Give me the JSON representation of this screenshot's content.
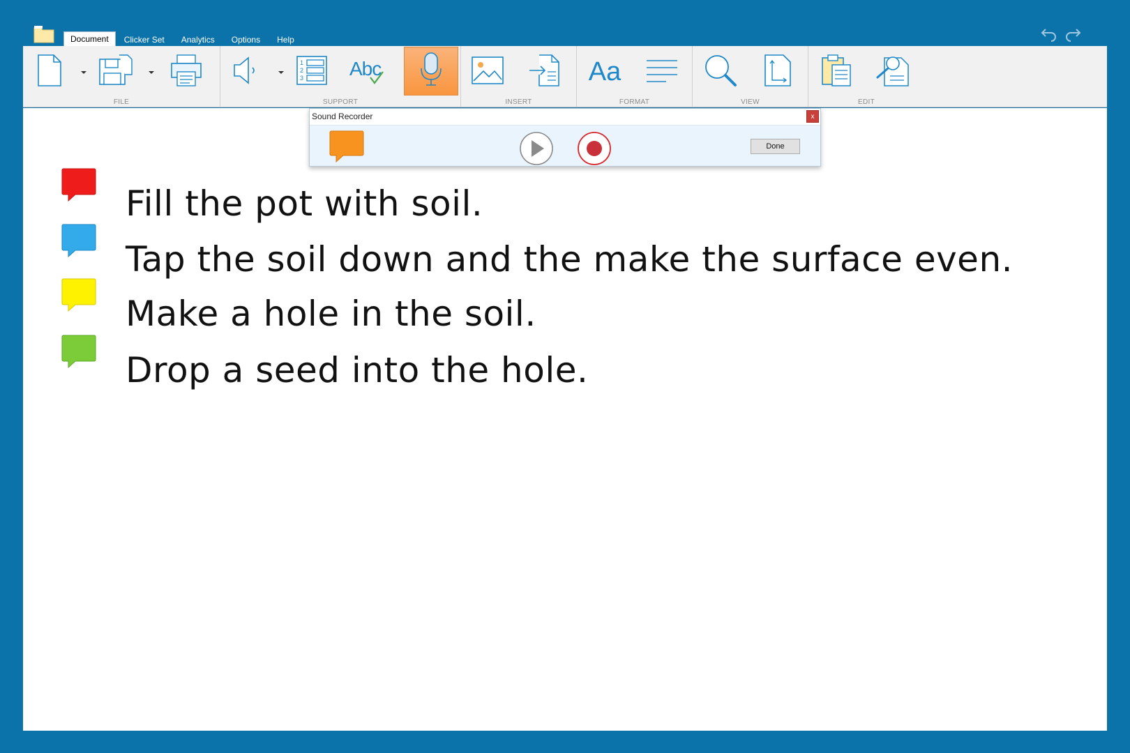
{
  "menu": {
    "tabs": [
      {
        "label": "Document",
        "active": true
      },
      {
        "label": "Clicker Set"
      },
      {
        "label": "Analytics"
      },
      {
        "label": "Options"
      },
      {
        "label": "Help"
      }
    ]
  },
  "ribbon": {
    "groups": [
      {
        "label": "FILE",
        "buttons": [
          "new-document-icon",
          "save-icon",
          "print-icon"
        ]
      },
      {
        "label": "SUPPORT",
        "buttons": [
          "speech-icon",
          "numbered-list-icon",
          "spell-check-icon",
          "microphone-icon"
        ]
      },
      {
        "label": "INSERT",
        "buttons": [
          "picture-icon",
          "insert-file-icon"
        ]
      },
      {
        "label": "FORMAT",
        "buttons": [
          "font-icon",
          "align-text-icon"
        ]
      },
      {
        "label": "VIEW",
        "buttons": [
          "zoom-icon",
          "page-size-icon"
        ]
      },
      {
        "label": "EDIT",
        "buttons": [
          "paste-icon",
          "find-icon"
        ]
      }
    ],
    "font_button_label": "Aa",
    "spell_check_label": "Abc"
  },
  "recorder": {
    "title": "Sound Recorder",
    "close_label": "x",
    "done_label": "Done",
    "bubble_color": "#f7931e"
  },
  "document": {
    "lines": [
      {
        "text": "Fill the pot with soil.",
        "bubble_color": "#ef1c1c"
      },
      {
        "text": "Tap the soil down and the make the surface even.",
        "bubble_color": "#33aaea"
      },
      {
        "text": "Make a hole in the soil.",
        "bubble_color": "#fff200"
      },
      {
        "text": "Drop a seed into the hole.",
        "bubble_color": "#7ccc3a"
      }
    ]
  },
  "colors": {
    "frame": "#0c73aa",
    "ribbon_bg": "#f1f1f1",
    "active_button": "#f9a35a",
    "icon_stroke": "#1e88c8"
  }
}
